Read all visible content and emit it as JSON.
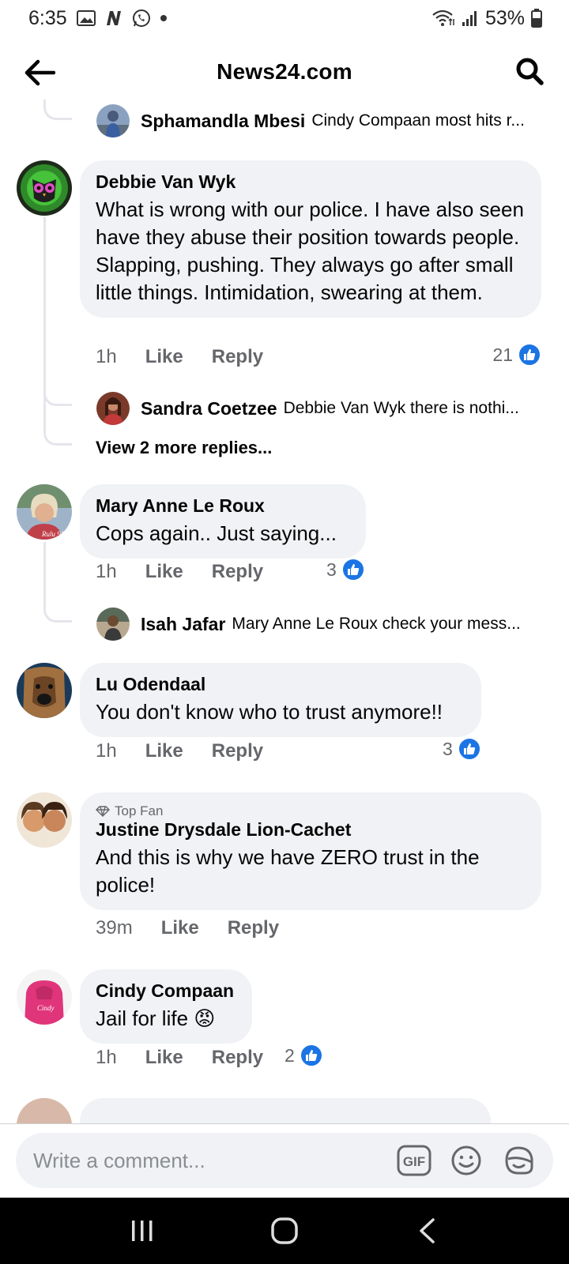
{
  "status_bar": {
    "time": "6:35",
    "battery": "53%",
    "icons_left": [
      "gallery-icon",
      "n-app-icon",
      "whatsapp-icon",
      "notification-dot"
    ],
    "icons_right": [
      "wifi-icon",
      "signal-icon",
      "battery-icon"
    ]
  },
  "header": {
    "title": "News24.com",
    "back_icon": "arrow-left-icon",
    "search_icon": "search-icon"
  },
  "comments": [
    {
      "reply_preview": {
        "name": "Sphamandla Mbesi",
        "text": "Cindy Compaan most hits r..."
      }
    },
    {
      "author": "Debbie Van Wyk",
      "text": "What is wrong with our police. I have also seen have they abuse their position towards people. Slapping, pushing. They always go after small little things. Intimidation, swearing at them.",
      "time": "1h",
      "like": "Like",
      "reply": "Reply",
      "reactions": "21",
      "replies": [
        {
          "name": "Sandra Coetzee",
          "text": "Debbie Van Wyk there is nothi..."
        }
      ],
      "view_more": "View 2 more replies..."
    },
    {
      "author": "Mary Anne Le Roux",
      "text": "Cops again.. Just saying...",
      "time": "1h",
      "like": "Like",
      "reply": "Reply",
      "reactions": "3",
      "replies": [
        {
          "name": "Isah Jafar",
          "text": "Mary Anne Le Roux check your mess..."
        }
      ]
    },
    {
      "author": "Lu Odendaal",
      "text": "You don't know who to trust anymore!!",
      "time": "1h",
      "like": "Like",
      "reply": "Reply",
      "reactions": "3"
    },
    {
      "badge": "Top Fan",
      "author": "Justine Drysdale Lion-Cachet",
      "text": "And this is why we have ZERO trust in the police!",
      "time": "39m",
      "like": "Like",
      "reply": "Reply"
    },
    {
      "author": "Cindy Compaan",
      "text": "Jail for life",
      "emoji": "😡",
      "time": "1h",
      "like": "Like",
      "reply": "Reply",
      "reactions": "2"
    }
  ],
  "composer": {
    "placeholder": "Write a comment...",
    "gif_label": "GIF"
  },
  "colors": {
    "accent": "#1b74e4",
    "bubble": "#f0f2f5",
    "secondary_text": "#65676b"
  }
}
